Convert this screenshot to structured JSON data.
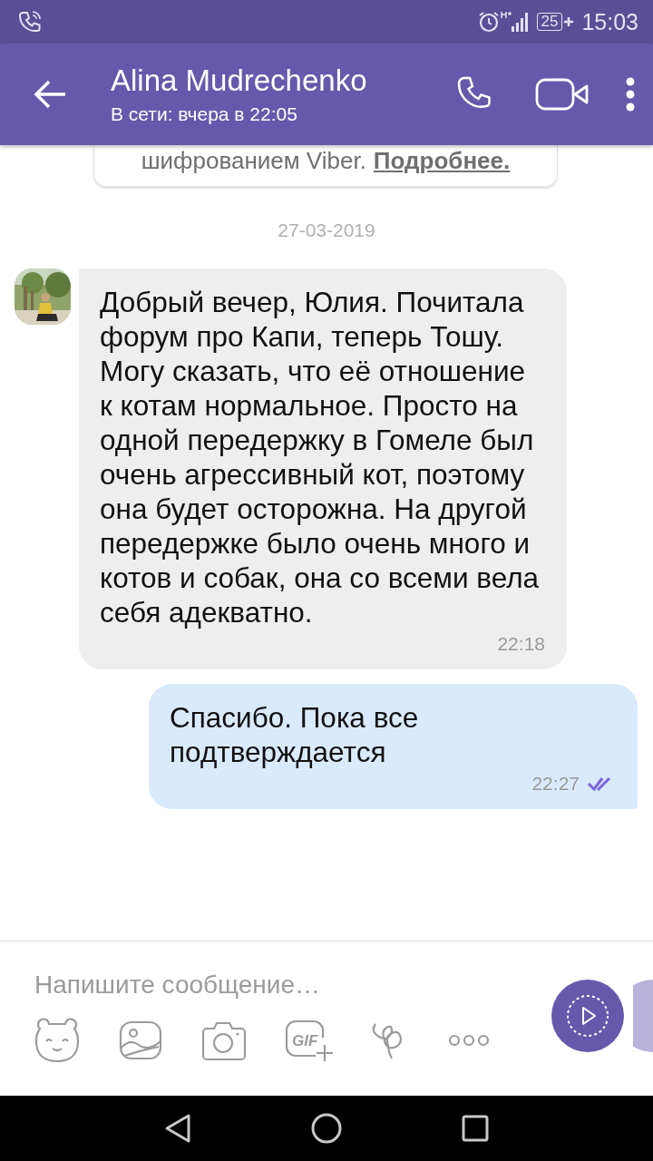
{
  "status_bar": {
    "battery": "25",
    "time": "15:03"
  },
  "header": {
    "title": "Alina Mudrechenko",
    "subtitle": "В сети: вчера в 22:05"
  },
  "notice": {
    "text": "шифрованием Viber.",
    "link": "Подробнее."
  },
  "date_divider": "27-03-2019",
  "messages": [
    {
      "kind": "incoming",
      "text": "Добрый вечер, Юлия. Почитала форум про Капи, теперь Тошу. Могу сказать, что её отношение к котам нормальное. Просто на одной передержку в Гомеле был очень агрессивный кот, поэтому она будет осторожна. На другой передержке было очень много и котов и собак, она со всеми вела себя адекватно.",
      "time": "22:18"
    },
    {
      "kind": "outgoing",
      "text": "Спасибо. Пока все подтверждается",
      "time": "22:27",
      "read": true
    }
  ],
  "composer": {
    "placeholder": "Напишите сообщение…",
    "gif_label": "GIF"
  }
}
